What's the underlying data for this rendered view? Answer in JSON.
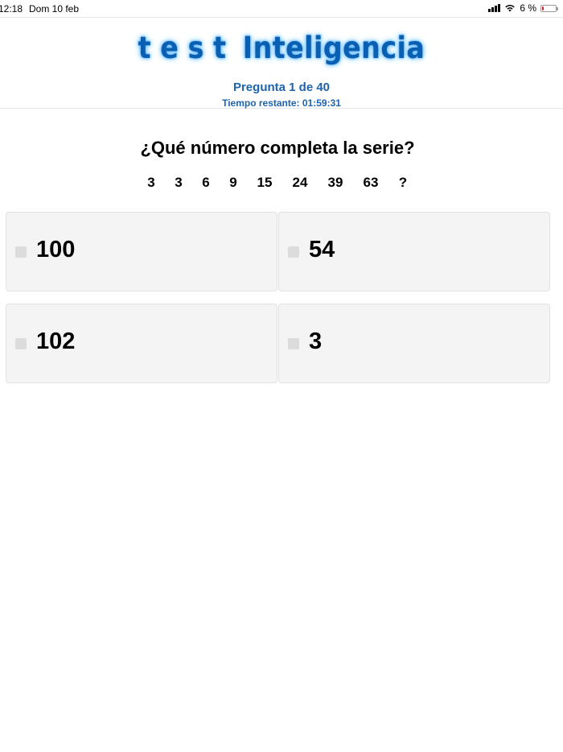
{
  "status_bar": {
    "time": "12:18",
    "date": "Dom 10 feb",
    "battery": "6 %",
    "battery_level": 0.06
  },
  "header": {
    "logo_part1": "test",
    "logo_part2": "Inteligencia",
    "progress": "Pregunta 1 de 40",
    "timer": "Tiempo restante: 01:59:31"
  },
  "question": {
    "text": "¿Qué número completa la serie?",
    "series": [
      "3",
      "3",
      "6",
      "9",
      "15",
      "24",
      "39",
      "63",
      "?"
    ]
  },
  "answers": [
    {
      "label": "100"
    },
    {
      "label": "54"
    },
    {
      "label": "102"
    },
    {
      "label": "3"
    }
  ],
  "colors": {
    "accent": "#1d63ad",
    "logo": "#0b5fb0",
    "answer_bg": "#f4f4f4",
    "battery_low": "#e02020"
  }
}
